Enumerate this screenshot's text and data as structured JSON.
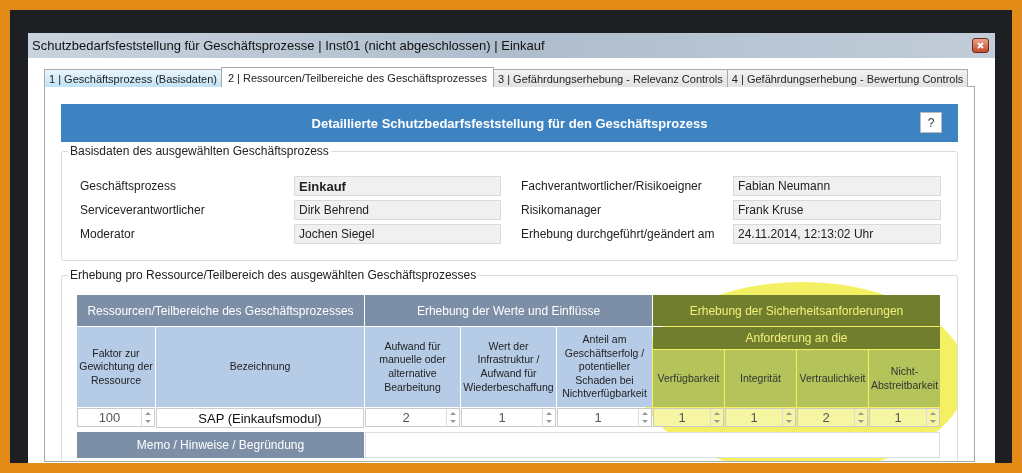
{
  "window": {
    "title": "Schutzbedarfsfeststellung für Geschäftsprozesse | Inst01 (nicht abgeschlossen) | Einkauf"
  },
  "tabs": [
    {
      "label": "1 | Geschäftsprozess (Basisdaten)",
      "selected": false
    },
    {
      "label": "2 | Ressourcen/Teilbereiche des Geschäftsprozesses",
      "selected": true
    },
    {
      "label": "3 | Gefährdungserhebung - Relevanz Controls",
      "selected": false
    },
    {
      "label": "4 | Gefährdungserhebung - Bewertung Controls",
      "selected": false
    }
  ],
  "header": {
    "title": "Detaillierte Schutzbedarfsfeststellung für den Geschäftsprozess",
    "help_button": "?"
  },
  "basisdaten": {
    "title": "Basisdaten des ausgewählten Geschäftsprozess",
    "fields": [
      {
        "label": "Geschäftsprozess",
        "value": "Einkauf",
        "bold": true
      },
      {
        "label": "Fachverantwortlicher/Risikoeigner",
        "value": "Fabian Neumann",
        "bold": false
      },
      {
        "label": "Serviceverantwortlicher",
        "value": "Dirk Behrend",
        "bold": false
      },
      {
        "label": "Risikomanager",
        "value": "Frank Kruse",
        "bold": false
      },
      {
        "label": "Moderator",
        "value": "Jochen Siegel",
        "bold": false
      },
      {
        "label": "Erhebung durchgeführt/geändert am",
        "value": "24.11.2014, 12:13:02 Uhr",
        "bold": false
      }
    ]
  },
  "erhebung": {
    "title": "Erhebung pro Ressource/Teilbereich des ausgewählten Geschäftsprozesses",
    "groups": [
      {
        "label": "Ressourcen/Teilbereiche des Geschäftsprozesses",
        "kind": "resource",
        "columns": [
          "Faktor zur Gewichtung der Ressource",
          "Bezeichnung"
        ]
      },
      {
        "label": "Erhebung der Werte und Einflüsse",
        "kind": "value",
        "columns": [
          "Aufwand für manuelle oder alternative Bearbeitung",
          "Wert der Infrastruktur / Aufwand für Wiederbeschaffung",
          "Anteil am Geschäftserfolg / potentieller Schaden bei Nichtverfügbarkeit"
        ]
      },
      {
        "label": "Erhebung der Sicherheitsanforderungen",
        "kind": "security",
        "subheader": "Anforderung an die",
        "columns": [
          "Verfügbarkeit",
          "Integrität",
          "Vertraulichkeit",
          "Nicht-Abstreitbarkeit"
        ]
      }
    ],
    "rows": [
      {
        "cells": [
          {
            "kind": "spin",
            "value": "100"
          },
          {
            "kind": "text",
            "value": "SAP (Einkaufsmodul)"
          },
          {
            "kind": "spin",
            "value": "2"
          },
          {
            "kind": "spin",
            "value": "1"
          },
          {
            "kind": "spin",
            "value": "1"
          },
          {
            "kind": "spin",
            "value": "1"
          },
          {
            "kind": "spin",
            "value": "1"
          },
          {
            "kind": "spin",
            "value": "2"
          },
          {
            "kind": "spin",
            "value": "1"
          }
        ]
      }
    ],
    "memo": {
      "label": "Memo / Hinweise / Begründung"
    }
  }
}
